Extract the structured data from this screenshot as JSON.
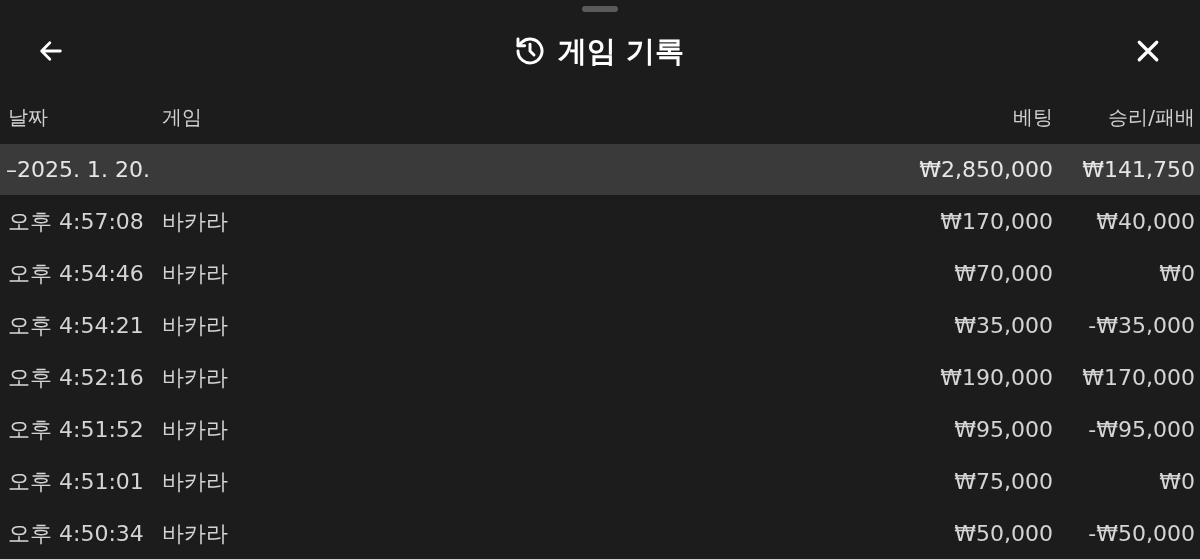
{
  "header": {
    "title": "게임 기록"
  },
  "table": {
    "columns": [
      "날짜",
      "게임",
      "베팅",
      "승리/패배"
    ],
    "group": {
      "date": "–2025. 1. 20.",
      "bet": "₩2,850,000",
      "result": "₩141,750"
    },
    "rows": [
      {
        "time": "오후 4:57:08",
        "game": "바카라",
        "bet": "₩170,000",
        "result": "₩40,000"
      },
      {
        "time": "오후 4:54:46",
        "game": "바카라",
        "bet": "₩70,000",
        "result": "₩0"
      },
      {
        "time": "오후 4:54:21",
        "game": "바카라",
        "bet": "₩35,000",
        "result": "-₩35,000"
      },
      {
        "time": "오후 4:52:16",
        "game": "바카라",
        "bet": "₩190,000",
        "result": "₩170,000"
      },
      {
        "time": "오후 4:51:52",
        "game": "바카라",
        "bet": "₩95,000",
        "result": "-₩95,000"
      },
      {
        "time": "오후 4:51:01",
        "game": "바카라",
        "bet": "₩75,000",
        "result": "₩0"
      },
      {
        "time": "오후 4:50:34",
        "game": "바카라",
        "bet": "₩50,000",
        "result": "-₩50,000"
      }
    ]
  }
}
